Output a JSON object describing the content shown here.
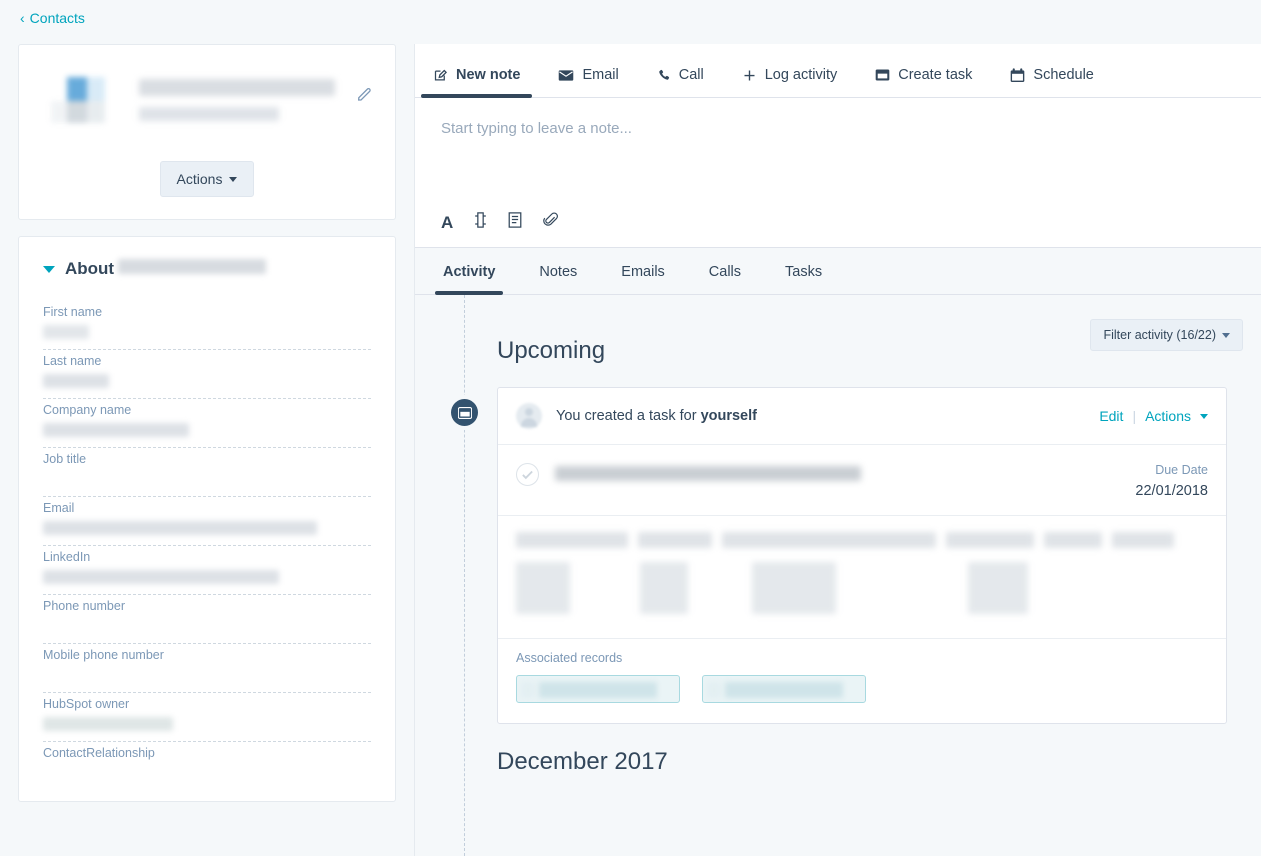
{
  "breadcrumb": {
    "icon": "chevron-left-icon",
    "label": "Contacts"
  },
  "contact_card": {
    "edit_icon": "pencil-icon",
    "actions_button": "Actions"
  },
  "about": {
    "title": "About",
    "collapse_icon": "chevron-down-icon",
    "fields": [
      {
        "label": "First name"
      },
      {
        "label": "Last name"
      },
      {
        "label": "Company name"
      },
      {
        "label": "Job title"
      },
      {
        "label": "Email"
      },
      {
        "label": "LinkedIn"
      },
      {
        "label": "Phone number"
      },
      {
        "label": "Mobile phone number"
      },
      {
        "label": "HubSpot owner"
      },
      {
        "label": "ContactRelationship"
      }
    ]
  },
  "compose": {
    "tabs": [
      {
        "label": "New note",
        "icon": "note-pencil-icon",
        "active": true
      },
      {
        "label": "Email",
        "icon": "envelope-icon",
        "active": false
      },
      {
        "label": "Call",
        "icon": "phone-icon",
        "active": false
      },
      {
        "label": "Log activity",
        "icon": "plus-icon",
        "active": false
      },
      {
        "label": "Create task",
        "icon": "task-square-icon",
        "active": false
      },
      {
        "label": "Schedule",
        "icon": "calendar-icon",
        "active": false
      }
    ],
    "placeholder": "Start typing to leave a note...",
    "toolbar": [
      {
        "icon": "font-color-icon",
        "label": "A"
      },
      {
        "icon": "insert-snippet-icon"
      },
      {
        "icon": "document-template-icon"
      },
      {
        "icon": "paperclip-attachment-icon"
      }
    ]
  },
  "activity_tabs": [
    {
      "label": "Activity",
      "active": true
    },
    {
      "label": "Notes",
      "active": false
    },
    {
      "label": "Emails",
      "active": false
    },
    {
      "label": "Calls",
      "active": false
    },
    {
      "label": "Tasks",
      "active": false
    }
  ],
  "timeline": {
    "filter_button": "Filter activity (16/22)",
    "upcoming_title": "Upcoming",
    "past_title": "December 2017",
    "card": {
      "badge_icon": "task-card-icon",
      "avatar_icon": "user-avatar-icon",
      "title_prefix": "You created a task for ",
      "title_target": "yourself",
      "edit_link": "Edit",
      "actions_link": "Actions",
      "divider": "|",
      "check_icon": "check-circle-icon",
      "due_label": "Due Date",
      "due_value": "22/01/2018",
      "associated_label": "Associated records"
    }
  },
  "colors": {
    "background": "#f5f8fa",
    "text": "#33475b",
    "link": "#00a4bd",
    "muted": "#7c98b6",
    "badge": "#33536f",
    "chip_border": "#a8d9e0"
  }
}
